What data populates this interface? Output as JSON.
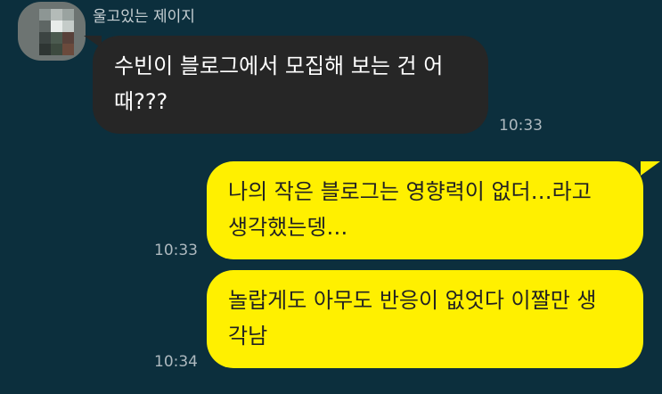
{
  "chat": {
    "sender": {
      "name": "울고있는 제이지"
    },
    "messages": [
      {
        "direction": "incoming",
        "lines": [
          "수빈이 블로그에서 모집해 보는 건 어",
          "때???"
        ],
        "time": "10:33"
      },
      {
        "direction": "outgoing",
        "lines": [
          "나의 작은 블로그는 영향력이 없더…라고",
          "생각했는뎅…"
        ],
        "time": "10:33"
      },
      {
        "direction": "outgoing",
        "lines": [
          "놀랍게도 아무도 반응이 없엇다 이짤만 생",
          "각남"
        ],
        "time": "10:34"
      }
    ]
  },
  "colors": {
    "background": "#0c2f3d",
    "incoming_bubble": "#262626",
    "outgoing_bubble": "#fff000",
    "timestamp": "#aeb9bf"
  }
}
